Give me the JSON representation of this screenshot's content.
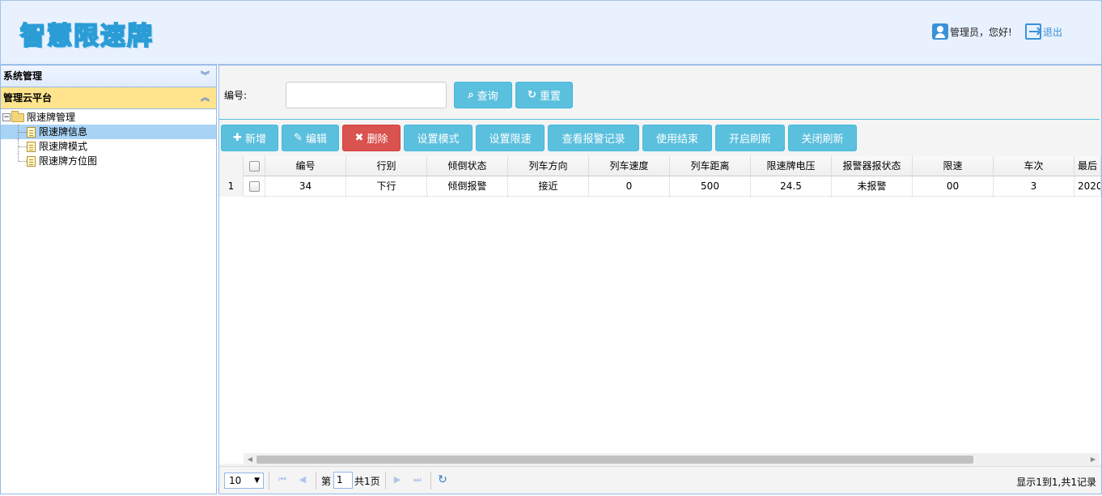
{
  "header": {
    "logo": "智慧限速牌",
    "greeting": "管理员，您好!",
    "logout": "退出"
  },
  "sidebar": {
    "panels": [
      {
        "title": "系统管理",
        "chevron": "︾"
      },
      {
        "title": "管理云平台",
        "chevron": "︽"
      }
    ],
    "tree": {
      "root": "限速牌管理",
      "collapse": "−",
      "items": [
        "限速牌信息",
        "限速牌模式",
        "限速牌方位图"
      ]
    }
  },
  "search": {
    "label": "编号:",
    "value": "",
    "placeholder": "",
    "query_label": "查询",
    "query_icon": "⌕",
    "reset_label": "重置",
    "reset_icon": "↻"
  },
  "toolbar": {
    "add": {
      "icon": "✚",
      "label": "新增"
    },
    "edit": {
      "icon": "✎",
      "label": "编辑"
    },
    "delete": {
      "icon": "✖",
      "label": "删除"
    },
    "set_mode": "设置模式",
    "set_limit": "设置限速",
    "view_alarms": "查看报警记录",
    "end_use": "使用结束",
    "start_refresh": "开启刷新",
    "stop_refresh": "关闭刷新"
  },
  "grid": {
    "columns": [
      "编号",
      "行别",
      "倾倒状态",
      "列车方向",
      "列车速度",
      "列车距离",
      "限速牌电压",
      "报警器报状态",
      "限速",
      "车次",
      "最后"
    ],
    "rows": [
      {
        "num": "1",
        "cells": [
          "34",
          "下行",
          "倾倒报警",
          "接近",
          "0",
          "500",
          "24.5",
          "未报警",
          "00",
          "3",
          "2020-"
        ]
      }
    ]
  },
  "scrollbar": {
    "left": "◀",
    "right": "▶"
  },
  "pager": {
    "page_size": "10",
    "dropdown": "▼",
    "first": "⏮",
    "prev": "◀",
    "page_prefix": "第",
    "page_value": "1",
    "page_suffix": "共1页",
    "next": "▶",
    "last": "⏭",
    "refresh": "↻",
    "info": "显示1到1,共1记录"
  }
}
